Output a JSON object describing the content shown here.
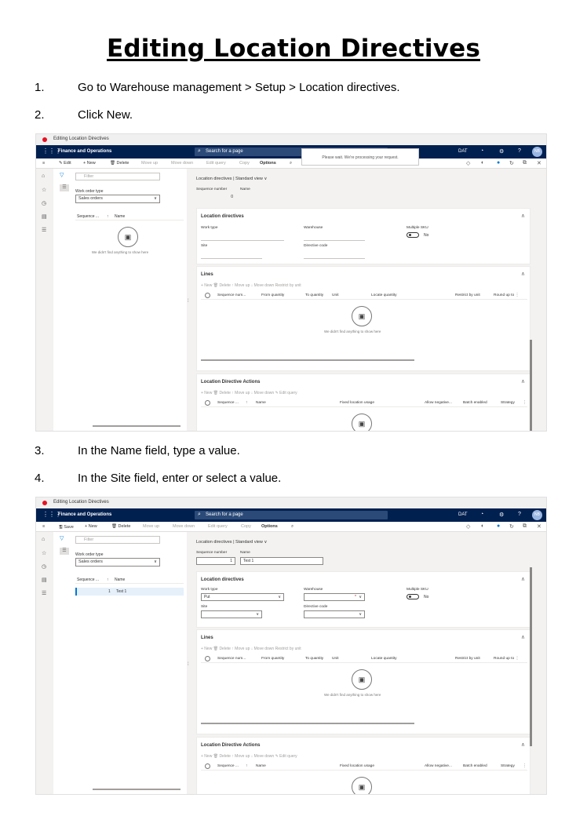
{
  "document": {
    "title": "Editing Location Directives",
    "steps": [
      {
        "num": "1.",
        "text": "Go to Warehouse management > Setup > Location directives."
      },
      {
        "num": "2.",
        "text": "Click New."
      },
      {
        "num": "3.",
        "text": "In the Name field, type a value."
      },
      {
        "num": "4.",
        "text": "In the Site field, enter or select a value."
      }
    ]
  },
  "shots": [
    {
      "window_title": "Editing Location Directives",
      "app_name": "Finance and Operations",
      "search_placeholder": "Search for a page",
      "busy_message": "Please wait. We're processing your request.",
      "company": "DAT",
      "user_initials": "NB",
      "actions": {
        "edit": "Edit",
        "new": "New",
        "delete": "Delete",
        "move_up": "Move up",
        "move_down": "Move down",
        "edit_query": "Edit query",
        "copy": "Copy",
        "options": "Options"
      },
      "filter_placeholder": "Filter",
      "work_order_type_label": "Work order type",
      "work_order_type_value": "Sales orders",
      "list_columns": [
        "Sequence ...",
        "↑",
        "Name"
      ],
      "list_empty": "We didn't find anything to show here",
      "breadcrumb": "Location directives  |  Standard view ∨",
      "seq_label": "Sequence number",
      "name_label": "Name",
      "seq_value": "0",
      "name_value": "",
      "section_location_directives": "Location directives",
      "work_type_label": "Work type",
      "work_type_value": "",
      "warehouse_label": "Warehouse",
      "multiple_sku_label": "Multiple SKU",
      "multiple_sku_value": "No",
      "site_label": "Site",
      "directive_code_label": "Directive code",
      "section_lines": "Lines",
      "lines_toolbar": "+ New    🗑 Delete    ↑ Move up    ↓ Move down    Restrict by unit",
      "lines_columns": [
        "Sequence num...",
        "From quantity",
        "To quantity",
        "Unit",
        "Locate quantity",
        "Restrict by unit",
        "Round up to ⋮"
      ],
      "lines_empty": "We didn't find anything to show here",
      "section_actions": "Location Directive Actions",
      "actions_toolbar": "+ New    🗑 Delete    ↑ Move up    ↓ Move down    ✎ Edit query",
      "actions_columns": [
        "Sequence ...",
        "↑",
        "Name",
        "Fixed location usage",
        "Allow negative...",
        "Batch enabled",
        "Strategy",
        "⋮"
      ]
    },
    {
      "window_title": "Editing Location Directives",
      "app_name": "Finance and Operations",
      "search_placeholder": "Search for a page",
      "company": "DAT",
      "user_initials": "NB",
      "actions": {
        "save": "Save",
        "new": "New",
        "delete": "Delete",
        "move_up": "Move up",
        "move_down": "Move down",
        "edit_query": "Edit query",
        "copy": "Copy",
        "options": "Options"
      },
      "filter_placeholder": "Filter",
      "work_order_type_label": "Work order type",
      "work_order_type_value": "Sales orders",
      "list_columns": [
        "Sequence ...",
        "↑",
        "Name"
      ],
      "list_row": {
        "seq": "1",
        "name": "Test 1"
      },
      "breadcrumb": "Location directives  |  Standard view ∨",
      "seq_label": "Sequence number",
      "name_label": "Name",
      "seq_value": "1",
      "name_value": "Test 1",
      "section_location_directives": "Location directives",
      "work_type_label": "Work type",
      "work_type_value": "Put",
      "warehouse_label": "Warehouse",
      "multiple_sku_label": "Multiple SKU",
      "multiple_sku_value": "No",
      "site_label": "Site",
      "directive_code_label": "Directive code",
      "section_lines": "Lines",
      "lines_toolbar": "+ New    🗑 Delete    ↑ Move up    ↓ Move down    Restrict by unit",
      "lines_columns": [
        "Sequence num...",
        "From quantity",
        "To quantity",
        "Unit",
        "Locate quantity",
        "Restrict by unit",
        "Round up to ⋮"
      ],
      "lines_empty": "We didn't find anything to show here",
      "section_actions": "Location Directive Actions",
      "actions_toolbar": "+ New    🗑 Delete    ↑ Move up    ↓ Move down    ✎ Edit query",
      "actions_columns": [
        "Sequence ...",
        "↑",
        "Name",
        "Fixed location usage",
        "Allow negative...",
        "Batch enabled",
        "Strategy",
        "⋮"
      ]
    }
  ]
}
